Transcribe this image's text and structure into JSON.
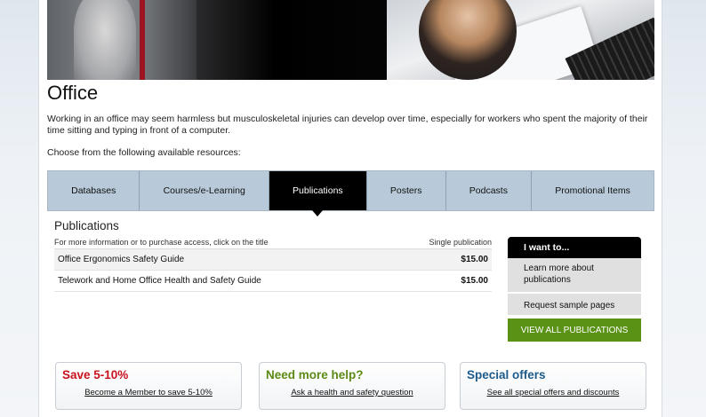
{
  "page": {
    "title": "Office",
    "intro": "Working in an office may seem harmless but musculoskeletal injuries can develop over time, especially for workers who spent the majority of their time sitting and typing in front of a computer.",
    "choose": "Choose from the following available resources:"
  },
  "tabs": [
    {
      "label": "Databases",
      "active": false
    },
    {
      "label": "Courses/e-Learning",
      "active": false
    },
    {
      "label": "Publications",
      "active": true
    },
    {
      "label": "Posters",
      "active": false
    },
    {
      "label": "Podcasts",
      "active": false
    },
    {
      "label": "Promotional Items",
      "active": false
    }
  ],
  "publications": {
    "heading": "Publications",
    "info_text": "For more information or to purchase access, click on the title",
    "column_label": "Single publication",
    "rows": [
      {
        "title": "Office Ergonomics Safety Guide",
        "price": "$15.00"
      },
      {
        "title": "Telework and Home Office Health and Safety Guide",
        "price": "$15.00"
      }
    ]
  },
  "want_to": {
    "heading": "I want to...",
    "items": [
      "Learn more about publications",
      "Request sample pages"
    ],
    "view_all": "VIEW ALL PUBLICATIONS"
  },
  "promos": [
    {
      "title": "Save 5-10%",
      "link": "Become a Member to save 5-10%",
      "color": "#c8101e"
    },
    {
      "title": "Need more help?",
      "link": "Ask a health and safety question",
      "color": "#5d8a16"
    },
    {
      "title": "Special offers",
      "link": "See all special offers and discounts",
      "color": "#1e5a8a"
    }
  ],
  "colors": {
    "tab_bg": "#b8cad9",
    "tab_active": "#000000",
    "view_all_green": "#5a9216"
  }
}
